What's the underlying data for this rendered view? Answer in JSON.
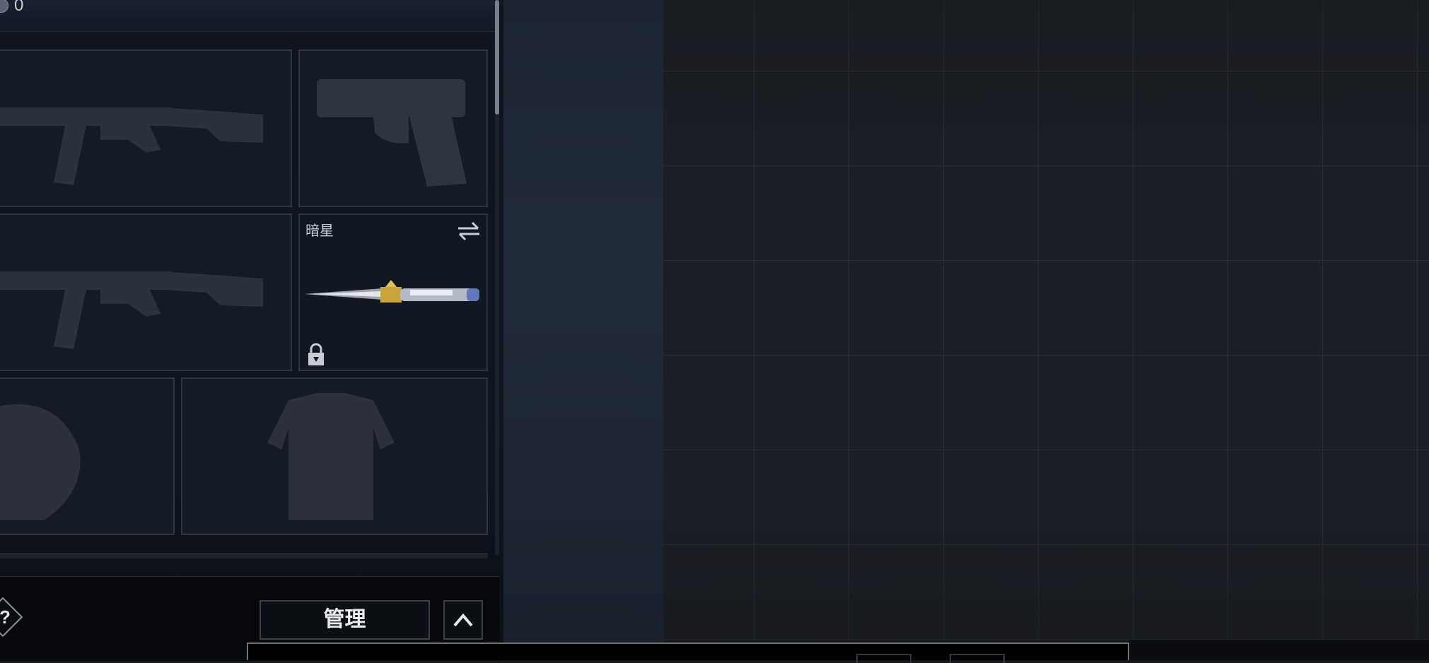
{
  "header": {
    "currency_value": "0"
  },
  "loadout": {
    "slots": [
      {
        "id": "primary-1",
        "item": "rifle",
        "label": ""
      },
      {
        "id": "secondary",
        "item": "pistol",
        "label": ""
      },
      {
        "id": "primary-2",
        "item": "rifle",
        "label": ""
      },
      {
        "id": "melee",
        "item": "knife",
        "label": "暗星",
        "locked": true,
        "has_swap": true
      },
      {
        "id": "helmet",
        "item": "helmet",
        "label": ""
      },
      {
        "id": "armor",
        "item": "vest",
        "label": ""
      }
    ]
  },
  "bottom_bar": {
    "help_label": "?",
    "manage_label": "管理"
  },
  "icons": [
    "swap-arrows-icon",
    "lock-icon",
    "chevron-up-icon",
    "help-icon",
    "currency-icon"
  ],
  "colors": {
    "background": "#15181d",
    "panel": "#101620",
    "accent_gold": "#c9a43a"
  }
}
